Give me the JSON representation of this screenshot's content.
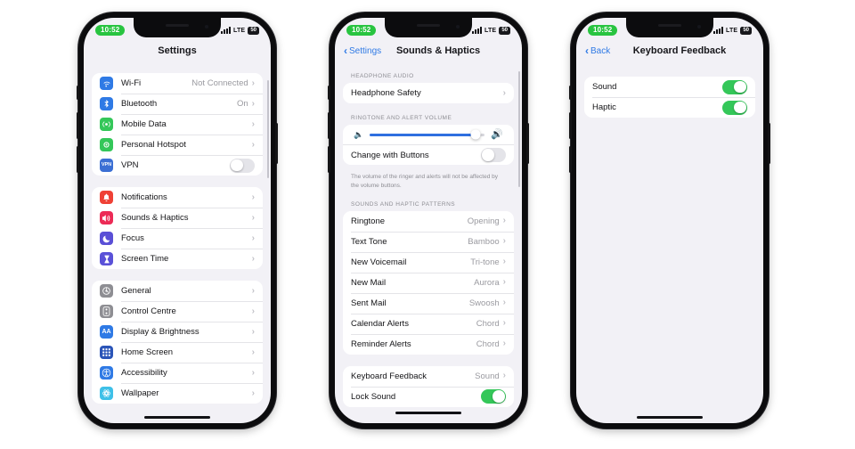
{
  "status": {
    "time": "10:52",
    "network": "LTE",
    "battery": "50",
    "signal_icon": "cellular-bars-icon",
    "battery_icon": "battery-icon"
  },
  "phones": [
    {
      "id": "phone-settings",
      "nav": {
        "title": "Settings",
        "back_label": "",
        "has_back": false
      },
      "groups": [
        {
          "header": "",
          "footer": "",
          "rows": [
            {
              "label": "Wi-Fi",
              "value": "Not Connected",
              "icon": "wifi-icon",
              "icon_color": "#2f7ae5",
              "accessory": "chevron"
            },
            {
              "label": "Bluetooth",
              "value": "On",
              "icon": "bluetooth-icon",
              "icon_color": "#2f7ae5",
              "accessory": "chevron"
            },
            {
              "label": "Mobile Data",
              "value": "",
              "icon": "mobile-data-icon",
              "icon_color": "#34c759",
              "accessory": "chevron"
            },
            {
              "label": "Personal Hotspot",
              "value": "",
              "icon": "hotspot-icon",
              "icon_color": "#34c759",
              "accessory": "chevron"
            },
            {
              "label": "VPN",
              "value": "",
              "icon": "vpn-icon",
              "icon_color": "#3b6fd4",
              "accessory": "toggle",
              "toggle_on": false
            }
          ]
        },
        {
          "header": "",
          "footer": "",
          "rows": [
            {
              "label": "Notifications",
              "value": "",
              "icon": "bell-icon",
              "icon_color": "#ef4136",
              "accessory": "chevron"
            },
            {
              "label": "Sounds & Haptics",
              "value": "",
              "icon": "speaker-icon",
              "icon_color": "#ec2b56",
              "accessory": "chevron"
            },
            {
              "label": "Focus",
              "value": "",
              "icon": "moon-icon",
              "icon_color": "#5a4fd6",
              "accessory": "chevron"
            },
            {
              "label": "Screen Time",
              "value": "",
              "icon": "hourglass-icon",
              "icon_color": "#5a51d8",
              "accessory": "chevron"
            }
          ]
        },
        {
          "header": "",
          "footer": "",
          "rows": [
            {
              "label": "General",
              "value": "",
              "icon": "gear-icon",
              "icon_color": "#8e8e93",
              "accessory": "chevron"
            },
            {
              "label": "Control Centre",
              "value": "",
              "icon": "sliders-icon",
              "icon_color": "#8e8e93",
              "accessory": "chevron"
            },
            {
              "label": "Display & Brightness",
              "value": "",
              "icon": "aa-icon",
              "icon_color": "#2f7ae5",
              "accessory": "chevron"
            },
            {
              "label": "Home Screen",
              "value": "",
              "icon": "grid-apps-icon",
              "icon_color": "#2b55b8",
              "accessory": "chevron"
            },
            {
              "label": "Accessibility",
              "value": "",
              "icon": "accessibility-icon",
              "icon_color": "#2f7ae5",
              "accessory": "chevron"
            },
            {
              "label": "Wallpaper",
              "value": "",
              "icon": "wallpaper-icon",
              "icon_color": "#3ec0e8",
              "accessory": "chevron"
            }
          ]
        }
      ]
    },
    {
      "id": "phone-sounds-haptics",
      "nav": {
        "title": "Sounds & Haptics",
        "back_label": "Settings",
        "has_back": true
      },
      "sections": {
        "headphone_audio": "HEADPHONE AUDIO",
        "ringtone_volume": "RINGTONE AND ALERT VOLUME",
        "sounds_patterns": "SOUNDS AND HAPTIC PATTERNS"
      },
      "headphone_rows": [
        {
          "label": "Headphone Safety",
          "value": "",
          "accessory": "chevron"
        }
      ],
      "volume": {
        "level_percent": 92,
        "low_icon": "speaker-low-icon",
        "high_icon": "speaker-high-icon",
        "change_with_buttons_label": "Change with Buttons",
        "change_with_buttons_on": false,
        "footnote": "The volume of the ringer and alerts will not be affected by the volume buttons."
      },
      "pattern_rows": [
        {
          "label": "Ringtone",
          "value": "Opening",
          "accessory": "chevron"
        },
        {
          "label": "Text Tone",
          "value": "Bamboo",
          "accessory": "chevron"
        },
        {
          "label": "New Voicemail",
          "value": "Tri-tone",
          "accessory": "chevron"
        },
        {
          "label": "New Mail",
          "value": "Aurora",
          "accessory": "chevron"
        },
        {
          "label": "Sent Mail",
          "value": "Swoosh",
          "accessory": "chevron"
        },
        {
          "label": "Calendar Alerts",
          "value": "Chord",
          "accessory": "chevron"
        },
        {
          "label": "Reminder Alerts",
          "value": "Chord",
          "accessory": "chevron"
        }
      ],
      "feedback_rows": [
        {
          "label": "Keyboard Feedback",
          "value": "Sound",
          "accessory": "chevron"
        },
        {
          "label": "Lock Sound",
          "value": "",
          "accessory": "toggle",
          "toggle_on": true
        }
      ]
    },
    {
      "id": "phone-keyboard-feedback",
      "nav": {
        "title": "Keyboard Feedback",
        "back_label": "Back",
        "has_back": true
      },
      "rows": [
        {
          "label": "Sound",
          "value": "",
          "accessory": "toggle",
          "toggle_on": true
        },
        {
          "label": "Haptic",
          "value": "",
          "accessory": "toggle",
          "toggle_on": true
        }
      ]
    }
  ],
  "colors": {
    "accent_blue": "#2f7ae5",
    "toggle_green": "#34c759",
    "slider_blue": "#2f6fe0",
    "screen_bg": "#f2f1f6",
    "card_bg": "#ffffff",
    "value_gray": "#9a9aa0"
  }
}
